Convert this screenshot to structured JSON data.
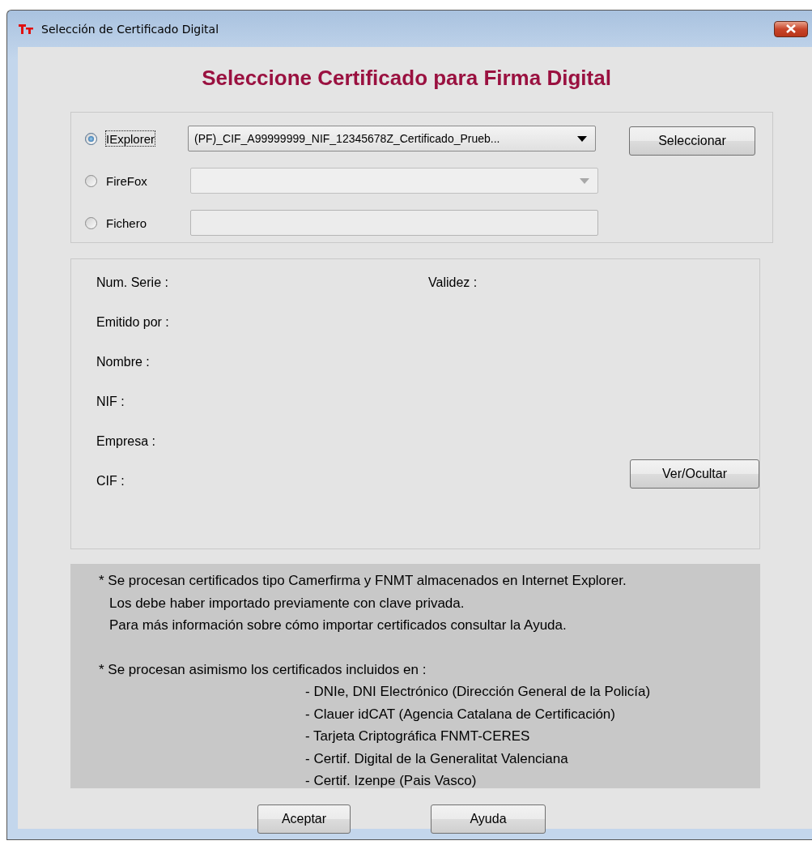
{
  "window": {
    "title": "Selección de Certificado Digital"
  },
  "heading": "Seleccione Certificado para Firma Digital",
  "sources": [
    {
      "label": "IExplorer",
      "selected": true,
      "focused": true,
      "field": {
        "kind": "dropdown",
        "value": "(PF)_CIF_A99999999_NIF_12345678Z_Certificado_Prueb...",
        "disabled": false
      }
    },
    {
      "label": "FireFox",
      "selected": false,
      "focused": false,
      "field": {
        "kind": "dropdown",
        "disabled": true
      }
    },
    {
      "label": "Fichero",
      "selected": false,
      "focused": false,
      "field": {
        "kind": "text"
      }
    }
  ],
  "select_button": "Seleccionar",
  "details": {
    "fields": [
      "Num. Serie :",
      "Emitido por :",
      "Nombre :",
      "NIF :",
      "Empresa :",
      "CIF :"
    ],
    "validity": "Validez :",
    "toggle_button": "Ver/Ocultar"
  },
  "notes": [
    {
      "lines": [
        "* Se procesan certificados tipo Camerfirma y FNMT almacenados en Internet Explorer.",
        "Los debe haber importado previamente con clave privada.",
        "Para más información sobre cómo importar certificados consultar la Ayuda."
      ]
    },
    {
      "lines": [
        "* Se procesan asimismo los certificados incluidos en :"
      ],
      "items": [
        "- DNIe, DNI Electrónico (Dirección General de la Policía)",
        "- Clauer idCAT (Agencia Catalana de Certificación)",
        "- Tarjeta Criptográfica FNMT-CERES",
        "- Certif. Digital de la Generalitat Valenciana",
        "- Certif. Izenpe (Pais Vasco)"
      ]
    }
  ],
  "buttons": [
    "Aceptar",
    "Ayuda"
  ]
}
